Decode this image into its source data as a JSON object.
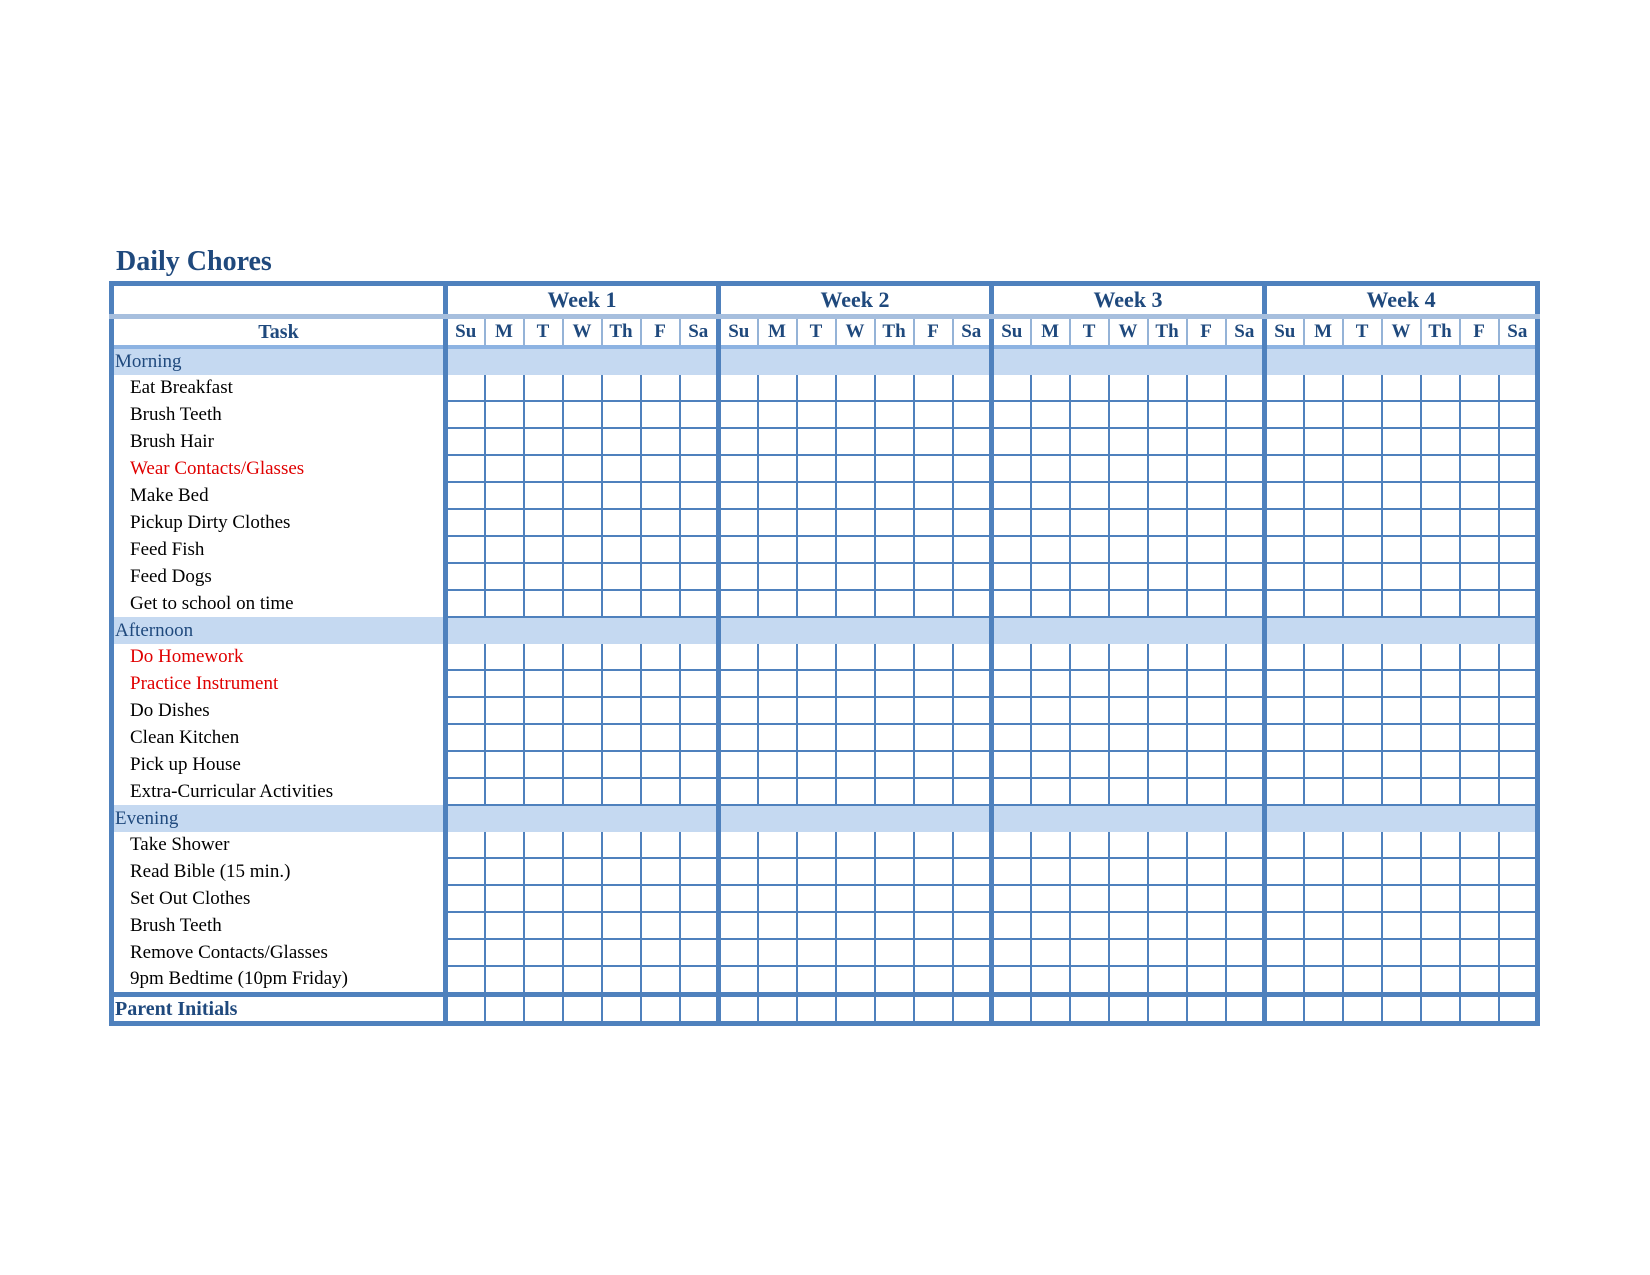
{
  "title": "Daily Chores",
  "colors": {
    "heading": "#1F497D",
    "border": "#4F81BD",
    "section_band": "#C5D9F1",
    "highlight_task": "#E00000"
  },
  "table": {
    "task_header": "Task",
    "weeks": [
      "Week 1",
      "Week 2",
      "Week 3",
      "Week 4"
    ],
    "days": [
      "Su",
      "M",
      "T",
      "W",
      "Th",
      "F",
      "Sa"
    ],
    "sections": [
      {
        "name": "Morning",
        "tasks": [
          {
            "label": "Eat Breakfast",
            "highlight": false
          },
          {
            "label": "Brush Teeth",
            "highlight": false
          },
          {
            "label": "Brush Hair",
            "highlight": false
          },
          {
            "label": "Wear Contacts/Glasses",
            "highlight": true
          },
          {
            "label": "Make Bed",
            "highlight": false
          },
          {
            "label": "Pickup Dirty Clothes",
            "highlight": false
          },
          {
            "label": "Feed Fish",
            "highlight": false
          },
          {
            "label": "Feed Dogs",
            "highlight": false
          },
          {
            "label": "Get to school on time",
            "highlight": false
          }
        ]
      },
      {
        "name": "Afternoon",
        "tasks": [
          {
            "label": "Do Homework",
            "highlight": true
          },
          {
            "label": "Practice Instrument",
            "highlight": true
          },
          {
            "label": "Do Dishes",
            "highlight": false
          },
          {
            "label": "Clean Kitchen",
            "highlight": false
          },
          {
            "label": "Pick up House",
            "highlight": false
          },
          {
            "label": "Extra-Curricular Activities",
            "highlight": false
          }
        ]
      },
      {
        "name": "Evening",
        "tasks": [
          {
            "label": "Take Shower",
            "highlight": false
          },
          {
            "label": "Read Bible (15 min.)",
            "highlight": false
          },
          {
            "label": "Set Out Clothes",
            "highlight": false
          },
          {
            "label": "Brush Teeth",
            "highlight": false
          },
          {
            "label": "Remove Contacts/Glasses",
            "highlight": false
          },
          {
            "label": "9pm Bedtime (10pm Friday)",
            "highlight": false
          }
        ]
      }
    ],
    "footer_label": "Parent Initials"
  }
}
